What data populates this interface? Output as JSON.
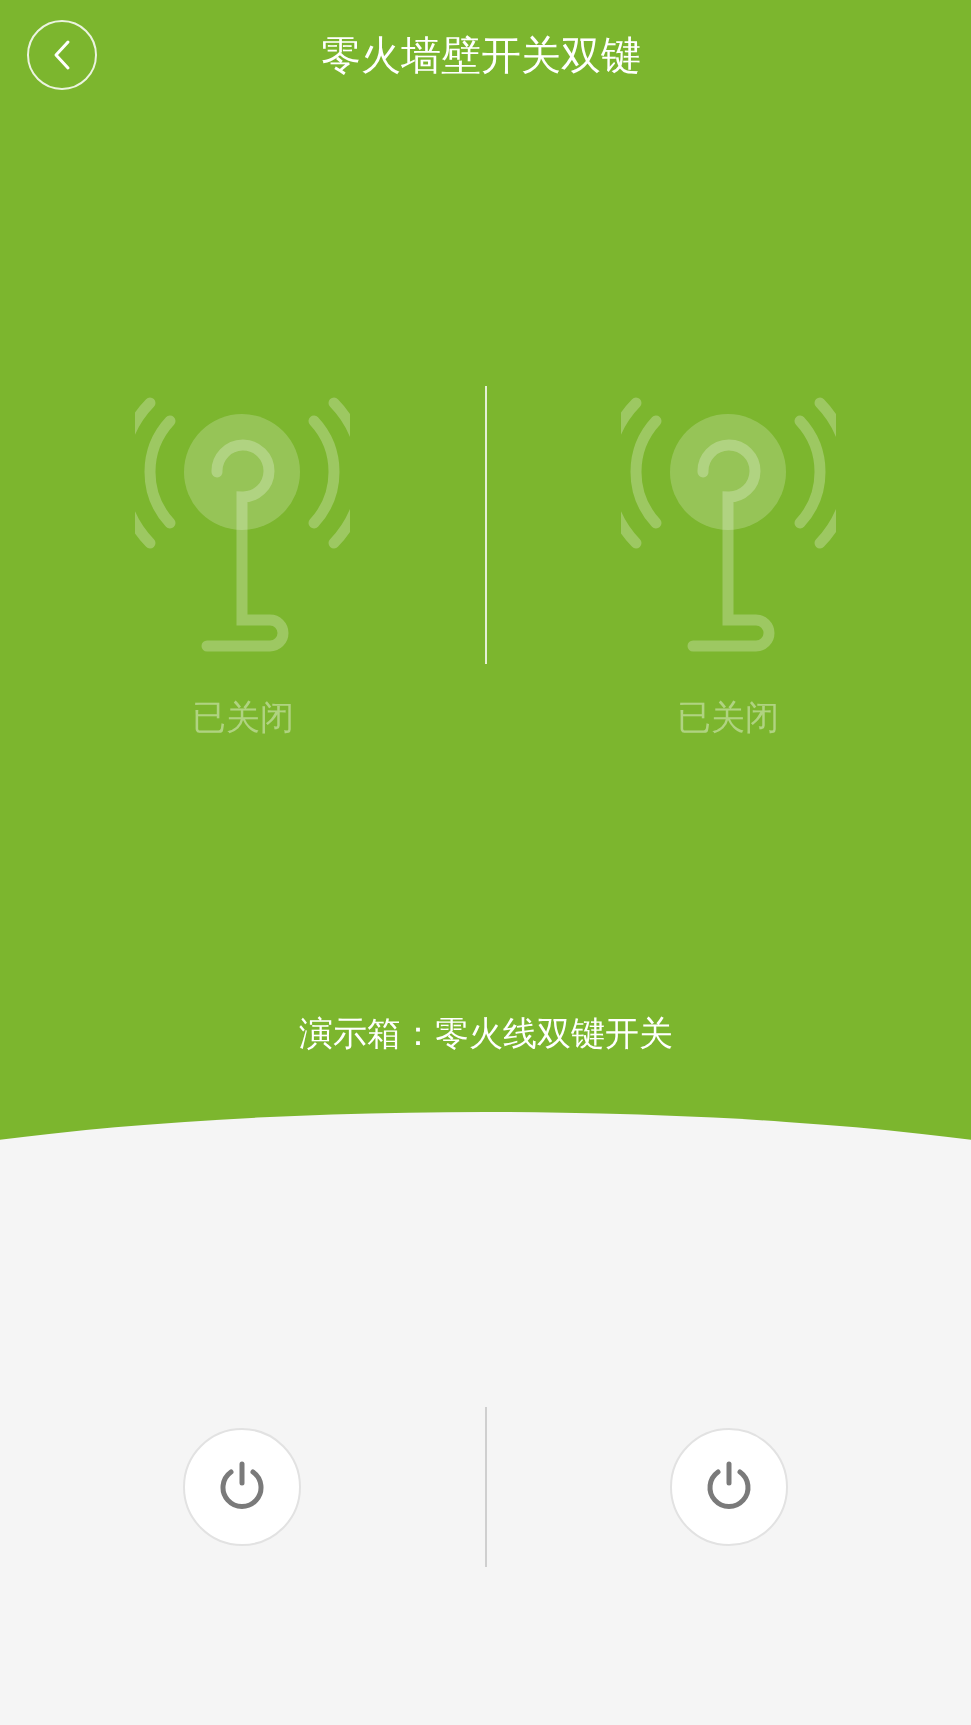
{
  "header": {
    "title": "零火墙壁开关双键"
  },
  "switches": [
    {
      "status": "已关闭",
      "on": false
    },
    {
      "status": "已关闭",
      "on": false
    }
  ],
  "demo_label": "演示箱：零火线双键开关"
}
